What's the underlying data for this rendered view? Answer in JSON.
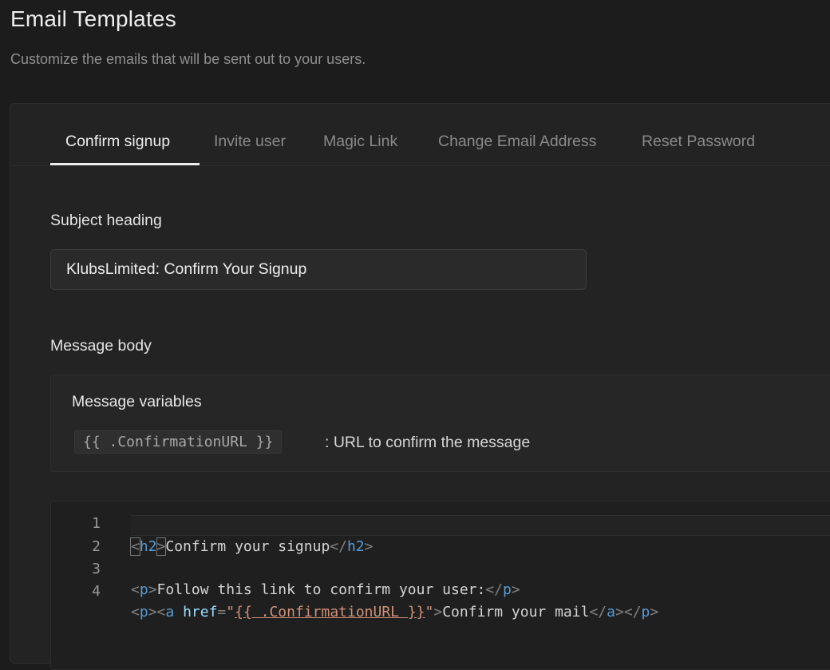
{
  "header": {
    "title": "Email Templates",
    "description": "Customize the emails that will be sent out to your users."
  },
  "tabs": [
    {
      "label": "Confirm signup",
      "active": true
    },
    {
      "label": "Invite user",
      "active": false
    },
    {
      "label": "Magic Link",
      "active": false
    },
    {
      "label": "Change Email Address",
      "active": false
    },
    {
      "label": "Reset Password",
      "active": false
    }
  ],
  "subject": {
    "label": "Subject heading",
    "value": "KlubsLimited: Confirm Your Signup"
  },
  "message": {
    "label": "Message body",
    "variables_title": "Message variables",
    "variables": [
      {
        "name": "{{ .ConfirmationURL }}",
        "description": ": URL to confirm the message"
      }
    ]
  },
  "editor": {
    "line_numbers": [
      "1",
      "2",
      "3",
      "4"
    ],
    "lines": {
      "l1": {
        "lt1": "<",
        "tag1": "h2",
        "gt1": ">",
        "text": "Confirm your signup",
        "lt2": "</",
        "tag2": "h2",
        "gt2": ">"
      },
      "l3": {
        "lt1": "<",
        "tag1": "p",
        "gt1": ">",
        "text": "Follow this link to confirm your user:",
        "lt2": "</",
        "tag2": "p",
        "gt2": ">"
      },
      "l4": {
        "lt1": "<",
        "tag1": "p",
        "gt1": ">",
        "lt2": "<",
        "tag2": "a",
        "sp": " ",
        "attr": "href",
        "eq": "=",
        "q1": "\"",
        "url": "{{ .ConfirmationURL }}",
        "q2": "\"",
        "gt2": ">",
        "text": "Confirm your mail",
        "lt3": "</",
        "tag3": "a",
        "gt3": ">",
        "lt4": "</",
        "tag4": "p",
        "gt4": ">"
      }
    }
  },
  "colors": {
    "background": "#1c1c1c",
    "card": "#232323",
    "tag": "#569cd6",
    "attribute": "#9cdcfe",
    "string": "#ce9178"
  }
}
